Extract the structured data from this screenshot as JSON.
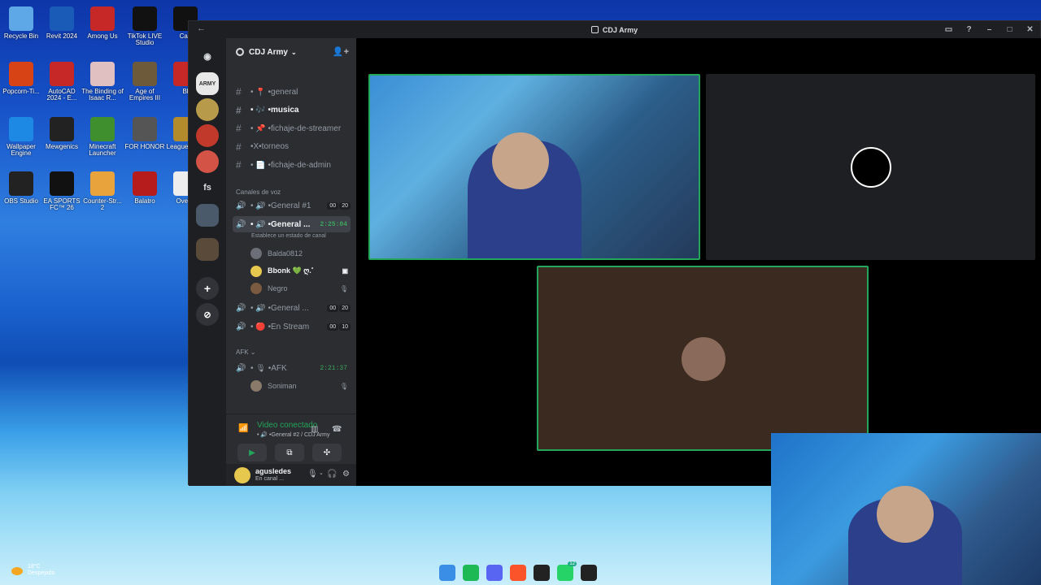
{
  "desktop": {
    "icons": [
      {
        "label": "Recycle Bin",
        "icon": "recycle-bin-icon",
        "color": "#5fa8e8"
      },
      {
        "label": "Revit 2024",
        "icon": "revit-icon",
        "color": "#1b5bb8"
      },
      {
        "label": "Among Us",
        "icon": "among-us-icon",
        "color": "#c62828"
      },
      {
        "label": "TikTok LIVE Studio",
        "icon": "tiktok-icon",
        "color": "#111111"
      },
      {
        "label": "Cap",
        "icon": "capcut-icon",
        "color": "#111111"
      },
      {
        "label": "Popcorn-Ti...",
        "icon": "popcorn-icon",
        "color": "#d84315"
      },
      {
        "label": "AutoCAD 2024 - E...",
        "icon": "autocad-icon",
        "color": "#c62828"
      },
      {
        "label": "The Binding of Isaac R...",
        "icon": "isaac-icon",
        "color": "#e0c0c0"
      },
      {
        "label": "Age of Empires III",
        "icon": "aoe-icon",
        "color": "#6d5a3a"
      },
      {
        "label": "Bl",
        "icon": "app-icon",
        "color": "#c62828"
      },
      {
        "label": "Wallpaper Engine",
        "icon": "wallpaper-engine-icon",
        "color": "#1e88e5"
      },
      {
        "label": "Mewgenics",
        "icon": "paw-icon",
        "color": "#222222"
      },
      {
        "label": "Minecraft Launcher",
        "icon": "minecraft-icon",
        "color": "#3f8f2f"
      },
      {
        "label": "FOR HONOR",
        "icon": "for-honor-icon",
        "color": "#555555"
      },
      {
        "label": "League Lege",
        "icon": "league-icon",
        "color": "#b38b2d"
      },
      {
        "label": "OBS Studio",
        "icon": "obs-icon",
        "color": "#222222"
      },
      {
        "label": "EA SPORTS FC™ 26",
        "icon": "ea-fc-icon",
        "color": "#111111"
      },
      {
        "label": "Counter-Str... 2",
        "icon": "cs2-icon",
        "color": "#e8a33d"
      },
      {
        "label": "Balatro",
        "icon": "balatro-icon",
        "color": "#b71c1c"
      },
      {
        "label": "Overw",
        "icon": "overwatch-icon",
        "color": "#eeeeee"
      }
    ],
    "weather": {
      "temp": "18°C",
      "desc": "Despejado"
    },
    "taskbar": [
      {
        "icon": "windows-start-icon",
        "color": "#3a8ee6",
        "badge": ""
      },
      {
        "icon": "spotify-icon",
        "color": "#1db954",
        "badge": ""
      },
      {
        "icon": "discord-icon",
        "color": "#5865f2",
        "badge": ""
      },
      {
        "icon": "brave-icon",
        "color": "#fb542b",
        "badge": ""
      },
      {
        "icon": "app-icon",
        "color": "#222222",
        "badge": ""
      },
      {
        "icon": "whatsapp-icon",
        "color": "#25d366",
        "badge": "12"
      },
      {
        "icon": "g-hub-icon",
        "color": "#222222",
        "badge": ""
      }
    ]
  },
  "window": {
    "title": "CDJ Army"
  },
  "server": {
    "name": "CDJ Army"
  },
  "channels": [
    {
      "name": "• 📍 •general",
      "type": "text"
    },
    {
      "name": "• 🎶 •musica",
      "type": "text",
      "bold": true
    },
    {
      "name": "• 📌 •fichaje-de-streamer",
      "type": "text"
    },
    {
      "name": "•X•torneos",
      "type": "text"
    },
    {
      "name": "• 📄 •fichaje-de-admin",
      "type": "text"
    }
  ],
  "voice_category": "Canales de voz",
  "voice_channels": [
    {
      "name": "• 🔊 •General #1",
      "count": "00",
      "limit": "20",
      "time": ""
    },
    {
      "name": "• 🔊 •General ...",
      "count": "",
      "limit": "",
      "time": "2:25:04",
      "active": true
    },
    {
      "name": "• 🔊 •General ...",
      "count": "00",
      "limit": "20",
      "time": ""
    },
    {
      "name": "• 🔴 •En Stream",
      "count": "00",
      "limit": "10",
      "time": ""
    }
  ],
  "status_hint": "Establece un estado de canal",
  "members": [
    {
      "name": "Balda0812",
      "ext": "",
      "color": "#6d6f78"
    },
    {
      "name": "Bbonk 💚 ღ.˚",
      "ext": "▣",
      "color": "#e6c84f"
    },
    {
      "name": "Negro",
      "ext": "🎙",
      "color": "#7a5a40"
    }
  ],
  "afk_category": "AFK",
  "afk_channel": {
    "name": "• 🎙 •AFK",
    "time": "2:21:37"
  },
  "afk_member": {
    "name": "Soniman",
    "ext": "🎙"
  },
  "voice_connection": {
    "status": "Video conectado",
    "channel": "• 🔊 •General #2 / CDJ Army"
  },
  "user": {
    "name": "agusledes",
    "status": "En canal ..."
  }
}
